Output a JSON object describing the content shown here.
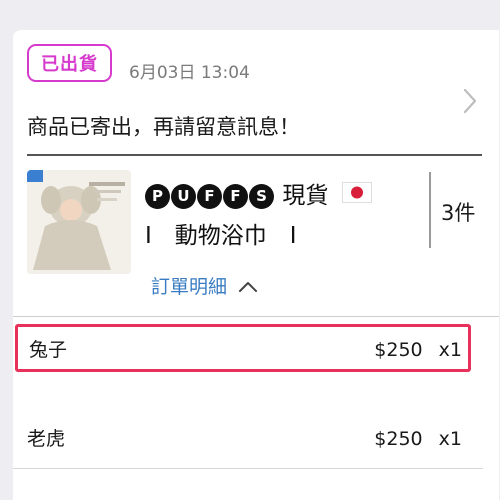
{
  "order": {
    "status_badge": "已出貨",
    "datetime": "6月03日 13:04",
    "status_message": "商品已寄出，再請留意訊息！"
  },
  "product": {
    "thumbnail_icon": "hooded-towel-product-photo",
    "title_letters": [
      "P",
      "U",
      "F",
      "F",
      "S"
    ],
    "title_suffix": "現貨",
    "flag_icon": "japan-flag-icon",
    "title_line2": "I　動物浴巾　I",
    "item_count": "3件",
    "detail_link": "訂單明細"
  },
  "line_items": [
    {
      "name": "兔子",
      "price": "$250",
      "qty": "x1",
      "highlighted": true
    },
    {
      "name": "老虎",
      "price": "$250",
      "qty": "x1",
      "highlighted": false
    }
  ],
  "colors": {
    "badge": "#d63acd",
    "link": "#3a7cc2",
    "highlight_border": "#e8315a"
  }
}
